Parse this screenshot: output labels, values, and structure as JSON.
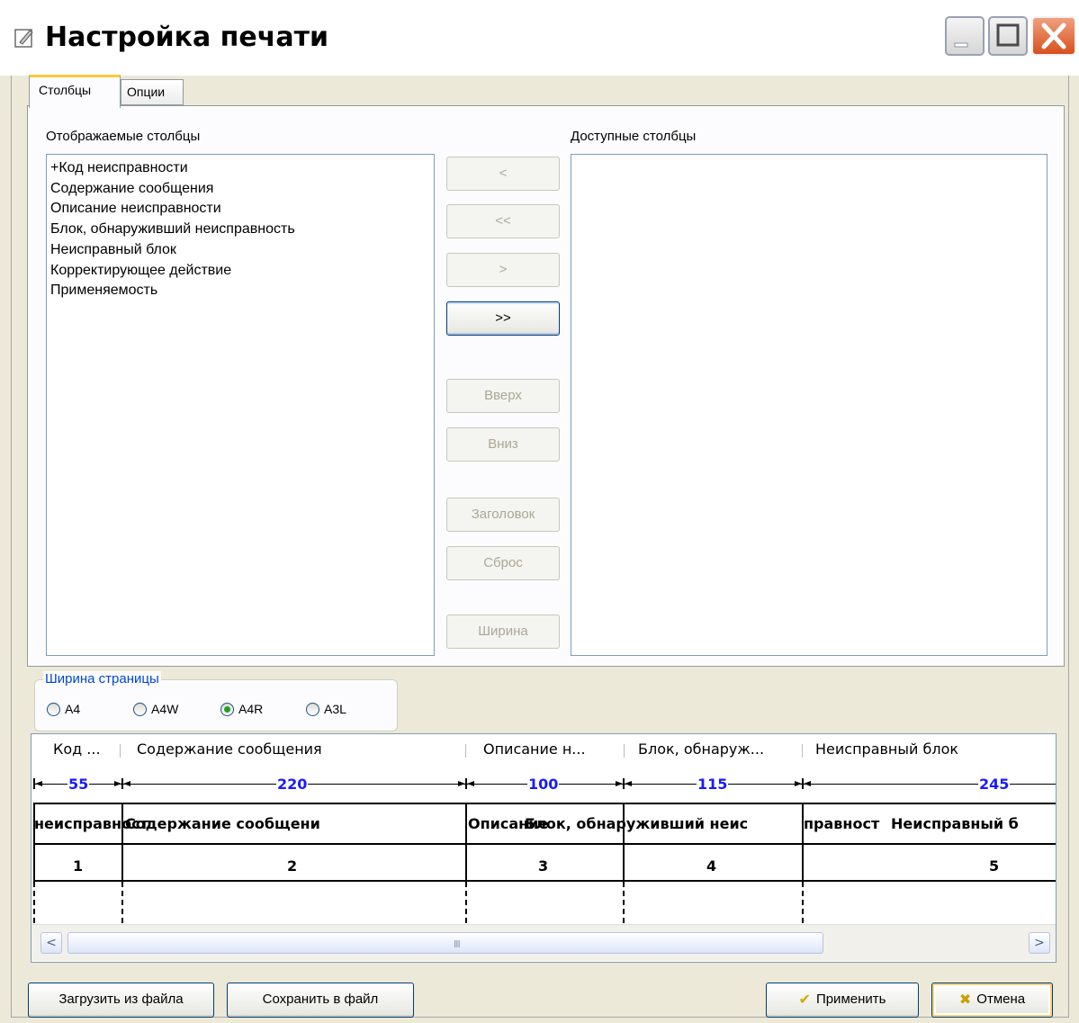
{
  "window": {
    "title": "Настройка печати"
  },
  "tabs": [
    {
      "label": "Столбцы"
    },
    {
      "label": "Опции"
    }
  ],
  "displayed": {
    "label": "Отображаемые столбцы",
    "items": [
      "+Код неисправности",
      "Содержание сообщения",
      "Описание неисправности",
      "Блок, обнаруживший неисправность",
      "Неисправный блок",
      "Корректирующее действие",
      "Применяемость"
    ]
  },
  "available": {
    "label": "Доступные столбцы",
    "items": []
  },
  "buttons": {
    "move_left": "<",
    "move_all_left": "<<",
    "move_right": ">",
    "move_all_right": ">>",
    "up": "Вверх",
    "down": "Вниз",
    "header": "Заголовок",
    "reset": "Сброс",
    "width": "Ширина"
  },
  "page_width": {
    "legend": "Ширина страницы",
    "options": [
      "A4",
      "A4W",
      "A4R",
      "A3L"
    ],
    "selected": "A4R"
  },
  "preview": {
    "headers": [
      "Код ...",
      "Содержание сообщения",
      "Описание н...",
      "Блок, обнаруж...",
      "Неисправный блок"
    ],
    "widths": [
      "55",
      "220",
      "100",
      "115",
      "245"
    ],
    "title_cells": [
      "неисправност",
      "Содержание сообщени",
      "Описание ",
      "Блок, обнаруживший неис",
      "правност",
      "Неисправный б"
    ],
    "numbers": [
      "1",
      "2",
      "3",
      "4",
      "5"
    ],
    "scroll": {
      "left_arrow": "<",
      "right_arrow": ">",
      "grip": "III"
    }
  },
  "footer": {
    "load": "Загрузить из файла",
    "save": "Сохранить в файл",
    "apply": "Применить",
    "cancel": "Отмена"
  },
  "icons": {
    "window": "edit-icon",
    "apply": "checkmark-icon",
    "cancel": "cross-icon"
  }
}
